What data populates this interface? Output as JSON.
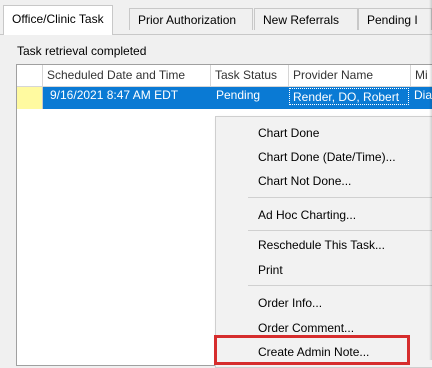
{
  "tabs": [
    {
      "label": "Office/Clinic Task"
    },
    {
      "label": "Prior Authorization"
    },
    {
      "label": "New Referrals"
    },
    {
      "label": "Pending I"
    }
  ],
  "status_text": "Task retrieval completed",
  "grid": {
    "columns": [
      "Scheduled Date and Time",
      "Task Status",
      "Provider Name",
      "Mi"
    ],
    "selected_row": {
      "scheduled": "9/16/2021   8:47 AM EDT",
      "status": "Pending",
      "provider": "Render, DO, Robert",
      "extra": "Dia"
    }
  },
  "context_menu": {
    "items": [
      "Chart Done",
      "Chart Done (Date/Time)...",
      "Chart Not Done...",
      "Ad Hoc Charting...",
      "Reschedule This Task...",
      "Print",
      "Order Info...",
      "Order Comment...",
      "Create Admin Note..."
    ]
  },
  "colors": {
    "selection": "#0a7ad4",
    "indicator": "#fffaa0",
    "highlight_box": "#d62d2d"
  }
}
